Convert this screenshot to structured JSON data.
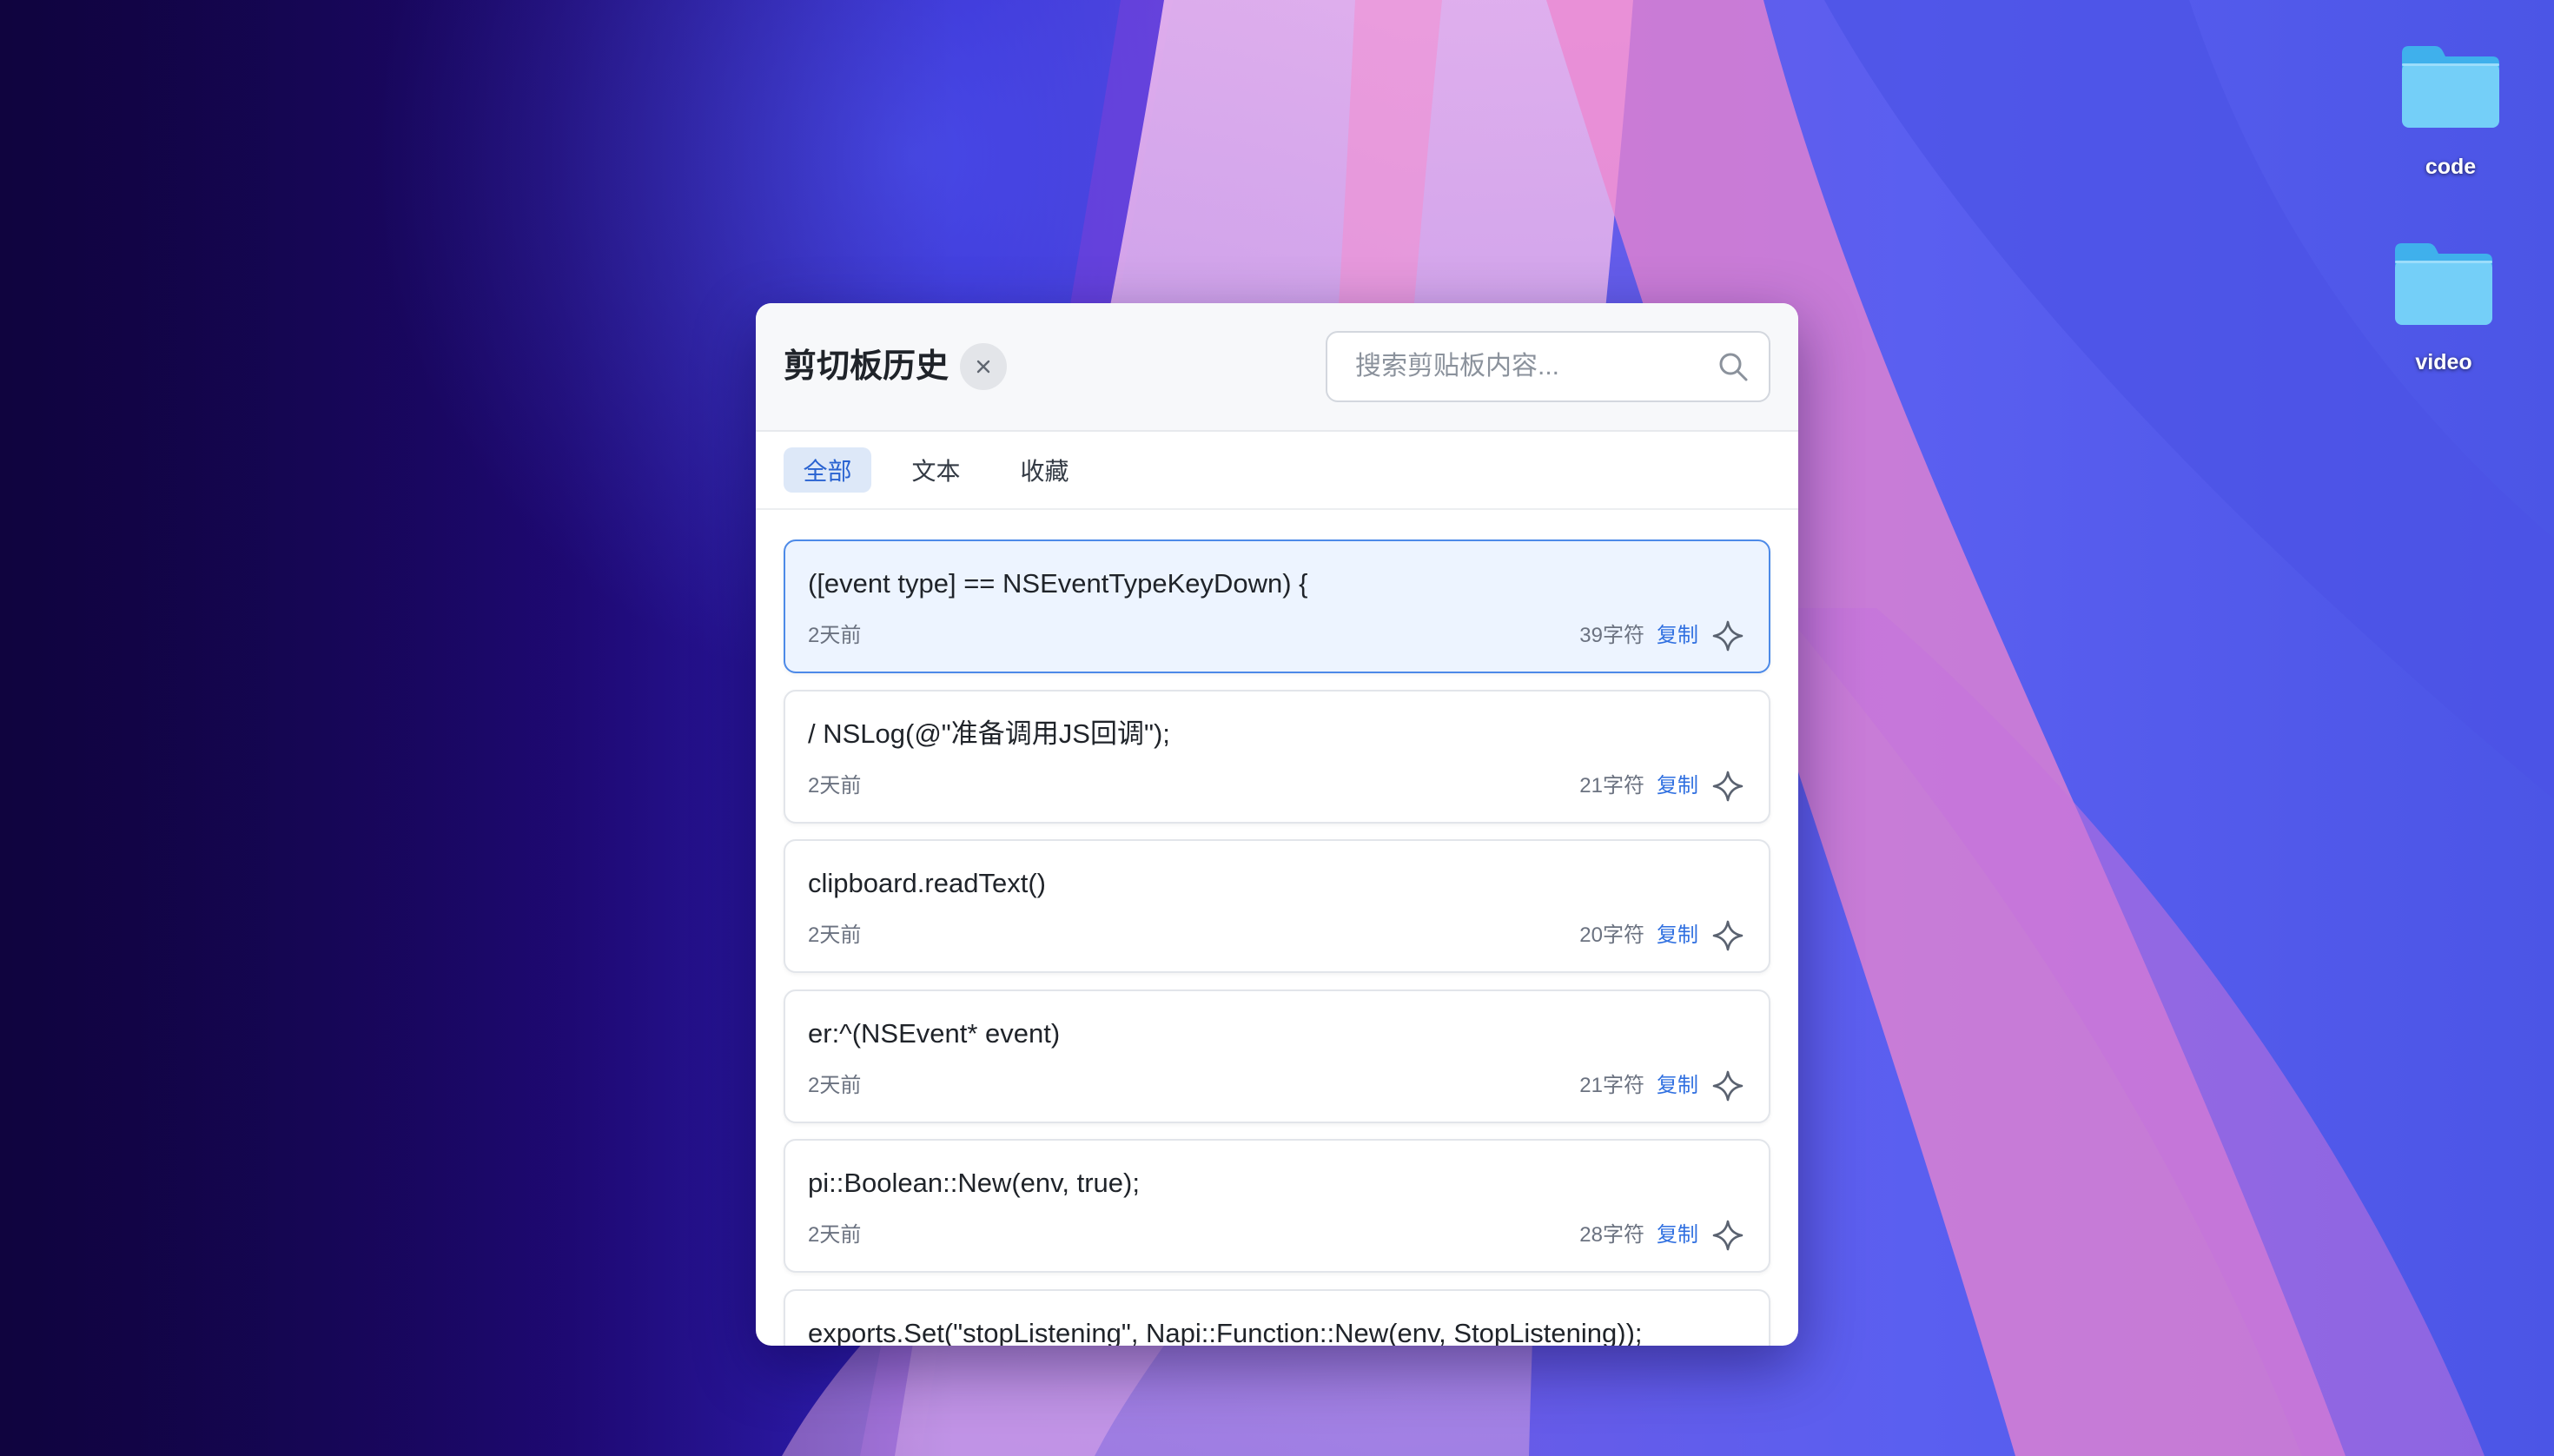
{
  "desktop": {
    "icons": [
      {
        "label": "code",
        "icon": "folder-icon"
      },
      {
        "label": "video",
        "icon": "folder-icon"
      }
    ]
  },
  "panel": {
    "title": "剪切板历史",
    "close_icon": "close-icon",
    "search": {
      "placeholder": "搜索剪贴板内容...",
      "icon": "search-icon"
    },
    "tabs": [
      {
        "label": "全部",
        "active": true
      },
      {
        "label": "文本",
        "active": false
      },
      {
        "label": "收藏",
        "active": false
      }
    ],
    "items": [
      {
        "text": "([event type] == NSEventTypeKeyDown) {",
        "time": "2天前",
        "chars": "39字符",
        "copy_label": "复制",
        "favorite_icon": "star-icon",
        "selected": true
      },
      {
        "text": "/ NSLog(@\"准备调用JS回调\");",
        "time": "2天前",
        "chars": "21字符",
        "copy_label": "复制",
        "favorite_icon": "star-icon",
        "selected": false
      },
      {
        "text": "clipboard.readText()",
        "time": "2天前",
        "chars": "20字符",
        "copy_label": "复制",
        "favorite_icon": "star-icon",
        "selected": false
      },
      {
        "text": "er:^(NSEvent* event)",
        "time": "2天前",
        "chars": "21字符",
        "copy_label": "复制",
        "favorite_icon": "star-icon",
        "selected": false
      },
      {
        "text": "pi::Boolean::New(env, true);",
        "time": "2天前",
        "chars": "28字符",
        "copy_label": "复制",
        "favorite_icon": "star-icon",
        "selected": false
      },
      {
        "text": "exports.Set(\"stopListening\", Napi::Function::New(env, StopListening));",
        "selected": false
      }
    ]
  },
  "colors": {
    "accent": "#2f6fe0",
    "tab_active_bg": "#dde8f8",
    "selected_card_bg": "#edf4ff",
    "selected_card_border": "#4d8ae8",
    "folder": "#74cff8"
  }
}
